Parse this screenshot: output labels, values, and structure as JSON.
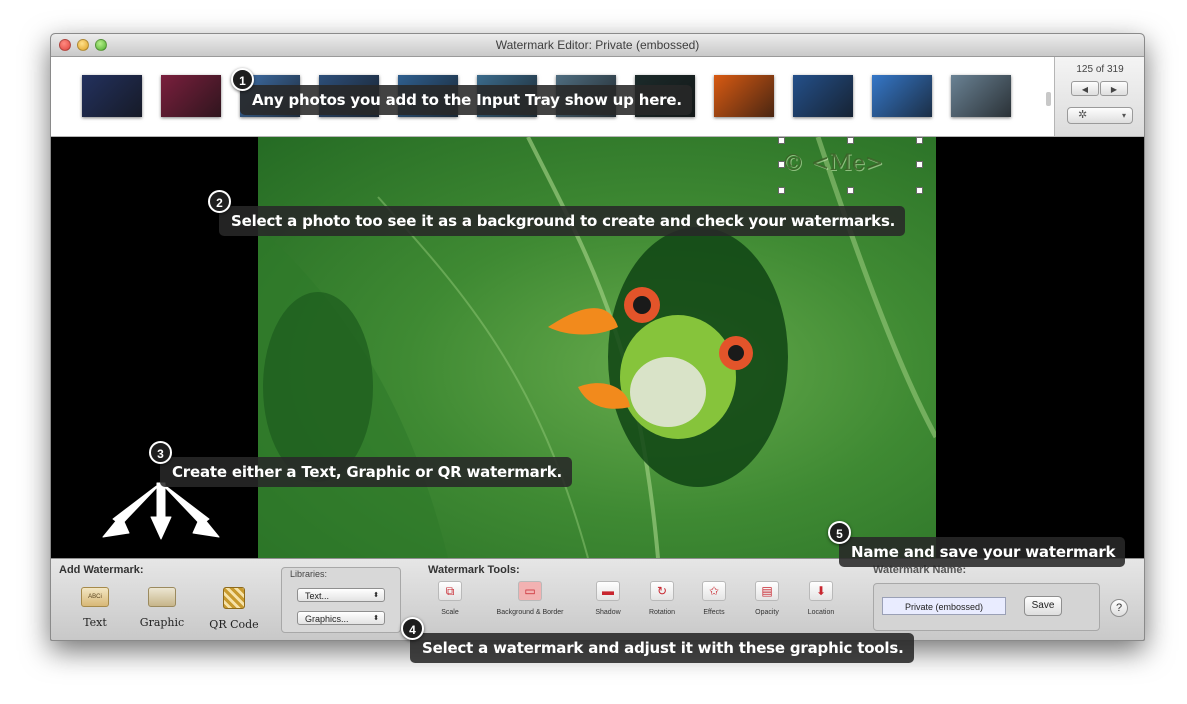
{
  "window": {
    "title": "Watermark Editor: Private (embossed)"
  },
  "tray": {
    "counter": "125 of 319",
    "prev_icon": "◀",
    "next_icon": "▶",
    "gear_icon": "✲",
    "thumbnails": [
      {
        "color": "#23315e"
      },
      {
        "color": "#7a1f3d"
      },
      {
        "color": "#3f6fa8"
      },
      {
        "color": "#2d4f7a"
      },
      {
        "color": "#2f5f8f"
      },
      {
        "color": "#3b6b8c"
      },
      {
        "color": "#4f6d80"
      },
      {
        "color": "#1b2a2a"
      },
      {
        "color": "#d85a12"
      },
      {
        "color": "#24508a"
      },
      {
        "color": "#3577c8"
      },
      {
        "color": "#6a8294"
      }
    ]
  },
  "canvas": {
    "watermark_text": "© <Me>"
  },
  "add_watermark": {
    "label": "Add Watermark:",
    "types": [
      {
        "label": "Text",
        "icon": "text-icon"
      },
      {
        "label": "Graphic",
        "icon": "graphic-icon"
      },
      {
        "label": "QR Code",
        "icon": "qr-code-icon"
      }
    ]
  },
  "libraries": {
    "label": "Libraries:",
    "text_popup": "Text...",
    "graphics_popup": "Graphics..."
  },
  "tools": {
    "label": "Watermark Tools:",
    "items": [
      {
        "label": "Scale",
        "icon": "scale-icon",
        "glyph": "⧉"
      },
      {
        "label": "Background & Border",
        "icon": "background-border-icon",
        "glyph": "▭"
      },
      {
        "label": "Shadow",
        "icon": "shadow-icon",
        "glyph": "▬"
      },
      {
        "label": "Rotation",
        "icon": "rotation-icon",
        "glyph": "↻"
      },
      {
        "label": "Effects",
        "icon": "effects-icon",
        "glyph": "✩"
      },
      {
        "label": "Opacity",
        "icon": "opacity-icon",
        "glyph": "▤"
      },
      {
        "label": "Location",
        "icon": "location-icon",
        "glyph": "⬇"
      }
    ]
  },
  "name_panel": {
    "label": "Watermark Name:",
    "value": "Private (embossed)",
    "save_label": "Save",
    "help_label": "?"
  },
  "callouts": [
    {
      "num": "1",
      "text": "Any photos you add to the Input Tray show up here."
    },
    {
      "num": "2",
      "text": "Select a photo too see it as a background to create and check your watermarks."
    },
    {
      "num": "3",
      "text": "Create either a Text, Graphic or QR watermark."
    },
    {
      "num": "4",
      "text": "Select a watermark and adjust it with these graphic tools."
    },
    {
      "num": "5",
      "text": "Name and save your watermark"
    }
  ]
}
